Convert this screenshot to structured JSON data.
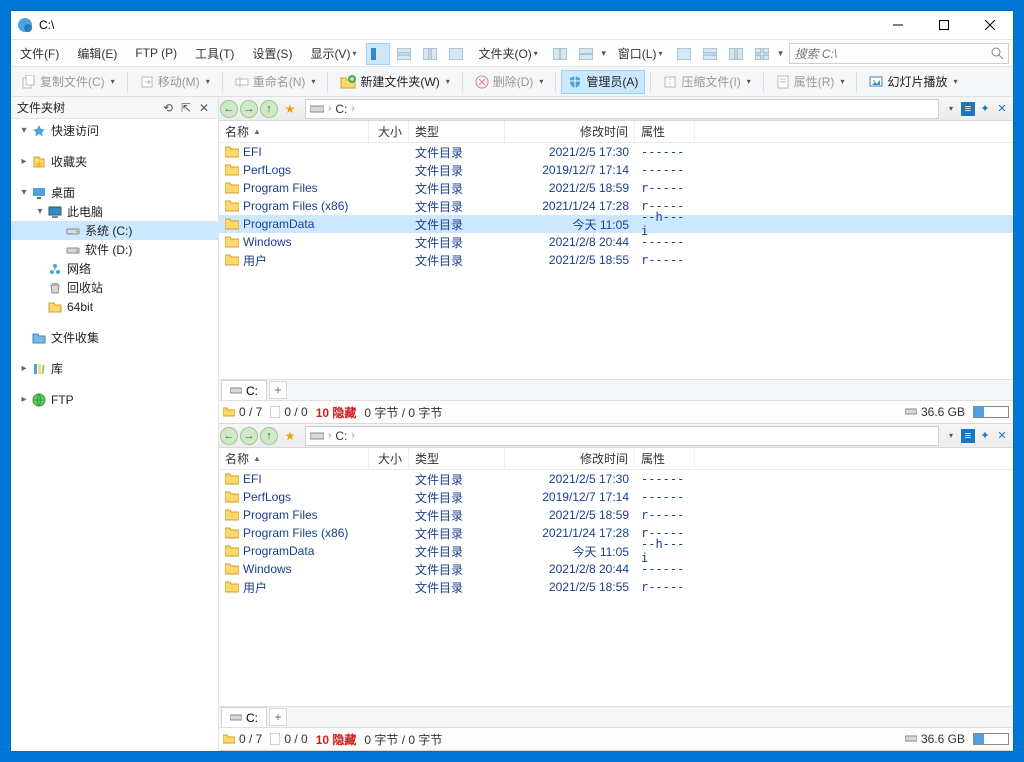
{
  "window": {
    "title": "C:\\"
  },
  "menu": {
    "file": "文件(F)",
    "edit": "编辑(E)",
    "ftp": "FTP (P)",
    "tools": "工具(T)",
    "settings": "设置(S)",
    "view": "显示(V)",
    "folder": "文件夹(O)",
    "window": "窗口(L)"
  },
  "search": {
    "placeholder": "搜索 C:\\"
  },
  "toolbar": {
    "copy": "复制文件(C)",
    "move": "移动(M)",
    "rename": "重命名(N)",
    "newfolder": "新建文件夹(W)",
    "delete": "删除(D)",
    "admin": "管理员(A)",
    "compress": "压缩文件(I)",
    "properties": "属性(R)",
    "slideshow": "幻灯片播放"
  },
  "sidebar": {
    "title": "文件夹树",
    "items": [
      {
        "label": "快速访问",
        "icon": "star",
        "depth": 0,
        "exp": "▾"
      },
      {
        "label": "收藏夹",
        "icon": "fav",
        "depth": 0,
        "exp": "▸",
        "gap": true
      },
      {
        "label": "桌面",
        "icon": "desktop",
        "depth": 0,
        "exp": "▾",
        "gap": true
      },
      {
        "label": "此电脑",
        "icon": "pc",
        "depth": 1,
        "exp": "▾"
      },
      {
        "label": "系统 (C:)",
        "icon": "drive",
        "depth": 2,
        "selected": true
      },
      {
        "label": "软件 (D:)",
        "icon": "drive",
        "depth": 2
      },
      {
        "label": "网络",
        "icon": "net",
        "depth": 1,
        "exp": " "
      },
      {
        "label": "回收站",
        "icon": "bin",
        "depth": 1,
        "exp": " "
      },
      {
        "label": "64bit",
        "icon": "folder",
        "depth": 1,
        "exp": " "
      },
      {
        "label": "文件收集",
        "icon": "folder-blue",
        "depth": 0,
        "exp": " ",
        "gap": true
      },
      {
        "label": "库",
        "icon": "lib",
        "depth": 0,
        "exp": "▸",
        "gap": true
      },
      {
        "label": "FTP",
        "icon": "ftp",
        "depth": 0,
        "exp": "▸",
        "gap": true
      }
    ]
  },
  "columns": {
    "name": "名称",
    "size": "大小",
    "type": "类型",
    "date": "修改时间",
    "attr": "属性"
  },
  "crumb": {
    "drive": "C:"
  },
  "files": [
    {
      "name": "EFI",
      "type": "文件目录",
      "date": "2021/2/5  17:30",
      "attr": "------"
    },
    {
      "name": "PerfLogs",
      "type": "文件目录",
      "date": "2019/12/7  17:14",
      "attr": "------"
    },
    {
      "name": "Program Files",
      "type": "文件目录",
      "date": "2021/2/5  18:59",
      "attr": "r-----"
    },
    {
      "name": "Program Files (x86)",
      "type": "文件目录",
      "date": "2021/1/24  17:28",
      "attr": "r-----"
    },
    {
      "name": "ProgramData",
      "type": "文件目录",
      "date": "今天  11:05",
      "attr": "--h---i",
      "sel": true
    },
    {
      "name": "Windows",
      "type": "文件目录",
      "date": "2021/2/8  20:44",
      "attr": "------"
    },
    {
      "name": "用户",
      "type": "文件目录",
      "date": "2021/2/5  18:55",
      "attr": "r-----"
    }
  ],
  "tab": {
    "label": "C:"
  },
  "status": {
    "folders": "0 / 7",
    "files": "0 / 0",
    "hidden": "10 隐藏",
    "bytes": "0 字节 / 0 字节",
    "disk": "36.6 GB"
  }
}
